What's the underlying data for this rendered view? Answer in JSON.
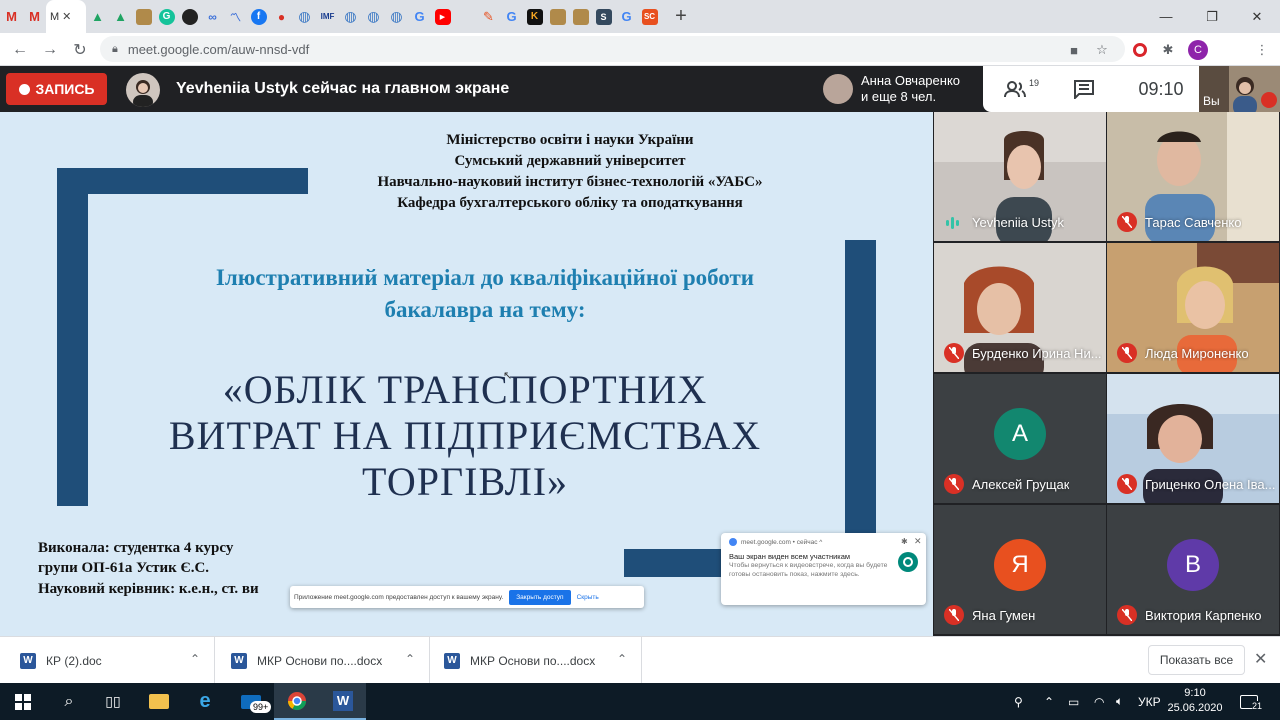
{
  "browser": {
    "active_tab_title": "M",
    "url": "meet.google.com/auw-nnsd-vdf",
    "profile_initial": "C"
  },
  "meet": {
    "record_label": "ЗАПИСЬ",
    "presenting_text": "Yevheniia Ustyk сейчас на главном экране",
    "joiner_line1": "Анна Овчаренко",
    "joiner_line2": "и еще 8 чел.",
    "participant_count": "19",
    "time": "09:10",
    "self_label": "Вы"
  },
  "slide": {
    "ministry_lines": [
      "Міністерство освіти і науки України",
      "Сумський державний університет",
      "Навчально-науковий  інститут бізнес-технологій «УАБС»",
      "Кафедра бухгалтерського обліку та оподаткування"
    ],
    "subtitle_lines": [
      "Ілюстративний матеріал до кваліфікаційної роботи",
      "бакалавра на тему:"
    ],
    "title_lines": [
      "«ОБЛІК ТРАНСПОРТНИХ",
      "ВИТРАТ НА ПІДПРИЄМСТВАХ",
      "ТОРГІВЛІ»"
    ],
    "author_lines": [
      "Виконала:  студентка 4 курсу",
      "групи ОП-61а  Устик Є.С.",
      "Науковий  керівник:  к.е.н., ст. ви"
    ]
  },
  "share_notice": {
    "text": "Приложение meet.google.com предоставлен доступ к вашему экрану.",
    "stop_label": "Закрыть доступ",
    "hide_label": "Скрыть"
  },
  "notification": {
    "source": "meet.google.com • сейчас ^",
    "title": "Ваш экран виден всем участникам",
    "body": "Чтобы вернуться к видеовстрече, когда вы будете готовы остановить показ, нажмите здесь."
  },
  "participants": [
    {
      "name": "Yevheniia Ustyk",
      "speaking": true
    },
    {
      "name": "Тарас Савченко",
      "muted": true
    },
    {
      "name": "Бурденко Ирина Ни...",
      "muted": true
    },
    {
      "name": "Люда Мироненко",
      "muted": true
    },
    {
      "name": "Алексей Грущак",
      "muted": true,
      "initial": "А",
      "color": "#12876f"
    },
    {
      "name": "Гриценко Олена Іва...",
      "muted": true
    },
    {
      "name": "Яна Гумен",
      "muted": true,
      "initial": "Я",
      "color": "#e8501f"
    },
    {
      "name": "Виктория Карпенко",
      "muted": true,
      "initial": "В",
      "color": "#5f3aa8"
    }
  ],
  "downloads": {
    "items": [
      "КР (2).doc",
      "МКР Основи по....docx",
      "МКР Основи по....docx"
    ],
    "show_all_label": "Показать все"
  },
  "taskbar": {
    "mail_badge": "99+",
    "language": "УКР",
    "clock_time": "9:10",
    "clock_date": "25.06.2020",
    "notification_count": "21"
  },
  "colors": {
    "record_red": "#d93025",
    "slide_bg": "#d8e9f6",
    "slide_bar": "#1f4e79",
    "subtitle_blue": "#1e7fb0"
  }
}
